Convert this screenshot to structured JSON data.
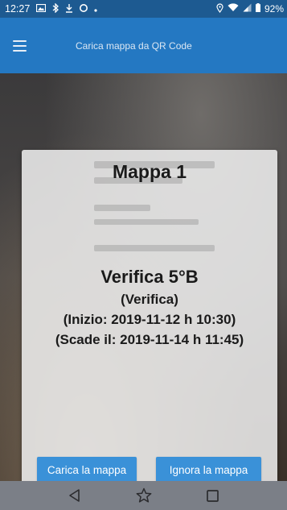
{
  "status_bar": {
    "time": "12:27",
    "battery": "92%",
    "left_icons": [
      "gallery-icon",
      "bluetooth-icon",
      "download-icon",
      "sync-icon",
      "dot-icon"
    ],
    "right_icons": [
      "location-icon",
      "wifi-icon",
      "signal-icon",
      "battery-icon"
    ]
  },
  "app_bar": {
    "title": "Carica mappa da QR Code",
    "menu_icon": "hamburger-menu-icon",
    "color": "#2478c2"
  },
  "dialog": {
    "map_title": "Mappa 1",
    "exam_title": "Verifica 5°B",
    "exam_type": "(Verifica)",
    "start": "(Inizio: 2019-11-12 h 10:30)",
    "due": "(Scade il: 2019-11-14 h 11:45)",
    "load_button": "Carica la mappa",
    "ignore_button": "Ignora la mappa",
    "button_color": "#3a91d8"
  },
  "nav_bar": {
    "icons": [
      "back-triangle-icon",
      "star-outline-icon",
      "square-recent-icon"
    ]
  }
}
